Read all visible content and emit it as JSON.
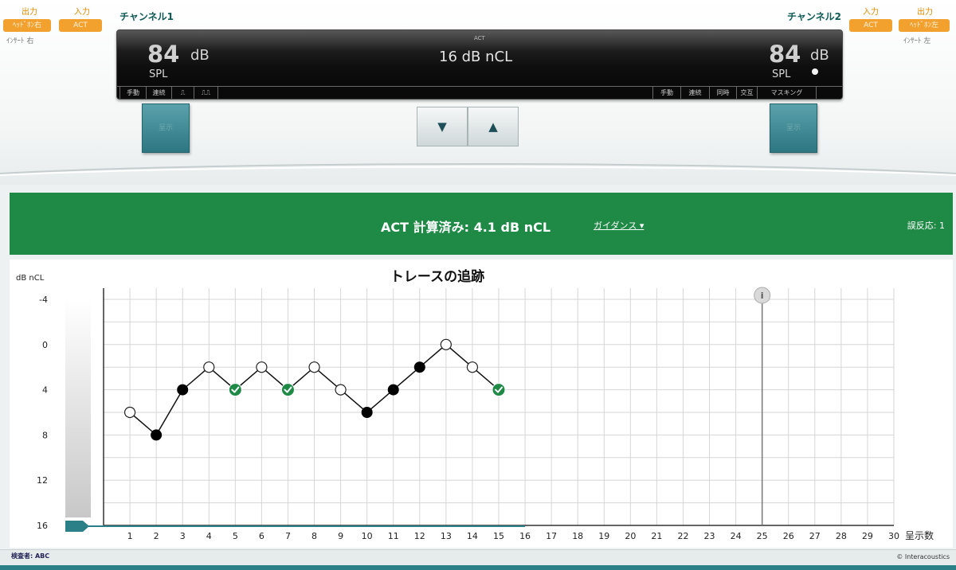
{
  "left_panel": {
    "output_label": "出力",
    "output_value": "ﾍｯﾄﾞﾎﾝ右",
    "input_label": "入力",
    "input_value": "ACT",
    "insert_label": "ｲﾝｻｰﾄ 右"
  },
  "right_panel": {
    "input_label": "入力",
    "input_value": "ACT",
    "output_label": "出力",
    "output_value": "ﾍｯﾄﾞﾎﾝ左",
    "insert_label": "ｲﾝｻｰﾄ 左"
  },
  "channel1": {
    "title": "チャンネル1",
    "level": "84",
    "unit": "dB",
    "scale": "SPL",
    "status": [
      "手動",
      "連続",
      "⎍",
      "⎍⎍"
    ]
  },
  "channel2": {
    "title": "チャンネル2",
    "level": "84",
    "unit": "dB",
    "scale": "SPL",
    "status": [
      "手動",
      "連続",
      "同時",
      "交互",
      "マスキング"
    ]
  },
  "display_center": {
    "small_label": "ACT",
    "value": "16 dB nCL"
  },
  "controls": {
    "present_left": "呈示",
    "present_right": "呈示",
    "down_glyph": "▼",
    "up_glyph": "▲"
  },
  "act_banner": {
    "result": "ACT 計算済み: 4.1 dB nCL",
    "guidance": "ガイダンス ▾",
    "false_responses": "誤反応: 1"
  },
  "chart_data": {
    "type": "line",
    "title": "トレースの追跡",
    "ylabel": "dB nCL",
    "xlabel": "呈示数",
    "y_reversed": true,
    "ylim": [
      -4,
      16
    ],
    "yticks": [
      -4,
      0,
      4,
      8,
      12,
      16
    ],
    "xlim": [
      0,
      30
    ],
    "xticks": [
      1,
      2,
      3,
      4,
      5,
      6,
      7,
      8,
      9,
      10,
      11,
      12,
      13,
      14,
      15,
      16,
      17,
      18,
      19,
      20,
      21,
      22,
      23,
      24,
      25,
      26,
      27,
      28,
      29,
      30
    ],
    "grid": true,
    "series": [
      {
        "x": [
          1,
          2,
          3,
          4,
          5,
          6,
          7,
          8,
          9,
          10,
          11,
          12,
          13,
          14,
          15
        ],
        "y": [
          6,
          8,
          4,
          2,
          4,
          2,
          4,
          2,
          4,
          6,
          4,
          2,
          0,
          2,
          4
        ],
        "marker": [
          "open",
          "filled",
          "filled",
          "open",
          "check",
          "open",
          "check",
          "open",
          "open",
          "filled",
          "filled",
          "filled",
          "open",
          "open",
          "check"
        ]
      }
    ],
    "level_line": {
      "value": 16,
      "x_end": 16
    },
    "marker_line": {
      "x": 25,
      "label": "i"
    },
    "colors": {
      "line": "#111111",
      "filled": "#000000",
      "open_fill": "#ffffff",
      "check_fill": "#1f8a46",
      "level_line": "#2b7f86",
      "grid": "#d6d6d6",
      "axis": "#333333"
    }
  },
  "footer": {
    "examiner": "検査者: ABC",
    "copyright": "© Interacoustics"
  }
}
